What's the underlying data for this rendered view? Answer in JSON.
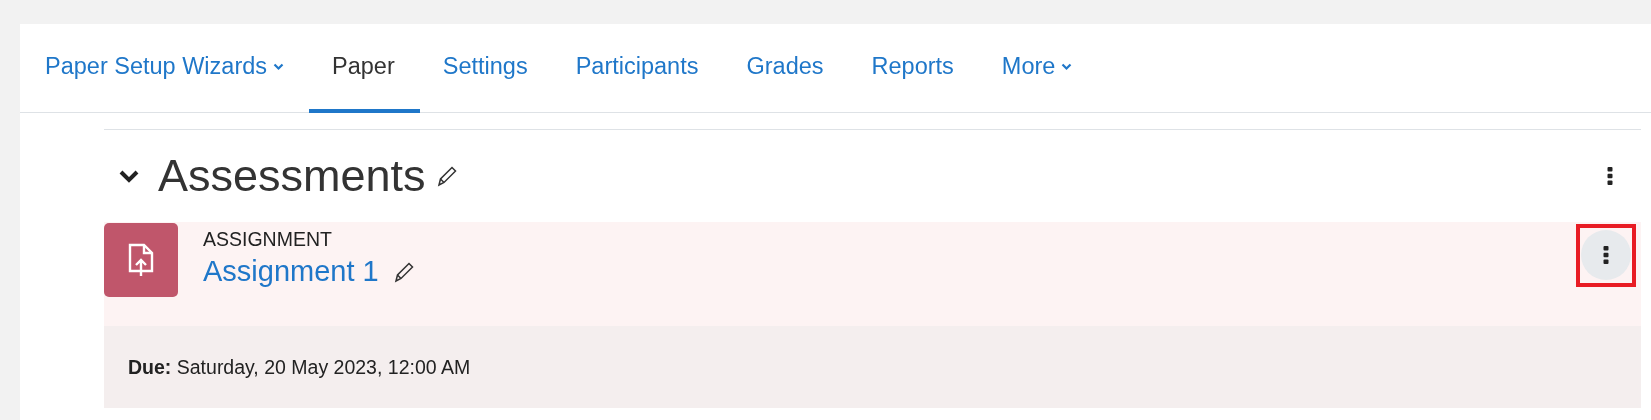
{
  "tabs": [
    {
      "label": "Paper Setup Wizards",
      "dropdown": true,
      "selected": false
    },
    {
      "label": "Paper",
      "dropdown": false,
      "selected": true
    },
    {
      "label": "Settings",
      "dropdown": false,
      "selected": false
    },
    {
      "label": "Participants",
      "dropdown": false,
      "selected": false
    },
    {
      "label": "Grades",
      "dropdown": false,
      "selected": false
    },
    {
      "label": "Reports",
      "dropdown": false,
      "selected": false
    },
    {
      "label": "More",
      "dropdown": true,
      "selected": false
    }
  ],
  "section": {
    "title": "Assessments",
    "expanded": true,
    "activities": [
      {
        "type": "ASSIGNMENT",
        "name": "Assignment 1",
        "due_label": "Due:",
        "due": "Saturday, 20 May 2023, 12:00 AM",
        "menu_highlighted": true
      }
    ]
  }
}
